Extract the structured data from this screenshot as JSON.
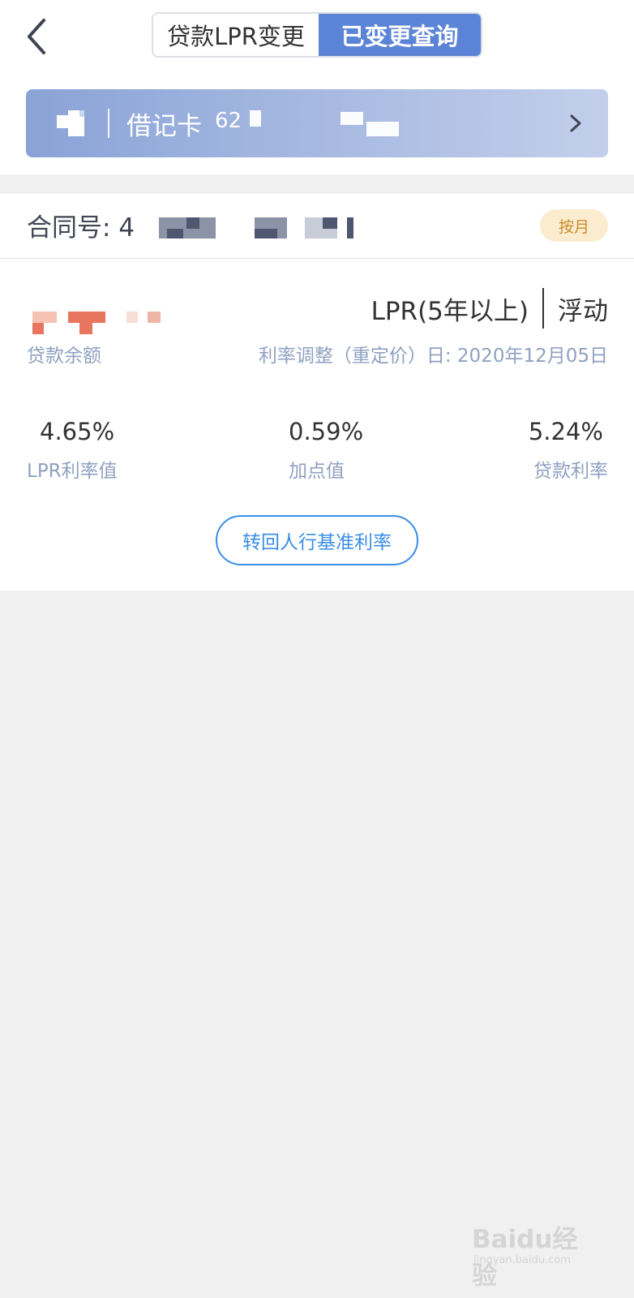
{
  "header": {
    "tab_change": "贷款LPR变更",
    "tab_query": "已变更查询",
    "active_tab": "已变更查询"
  },
  "account": {
    "card_label": "借记卡",
    "card_number_partial": "62"
  },
  "contract": {
    "label": "合同号:",
    "number_partial": "4",
    "repayment_badge": "按月"
  },
  "detail": {
    "balance_label": "贷款余额",
    "rate_type_main": "LPR(5年以上)",
    "rate_type_mode": "浮动",
    "reset_date": "利率调整（重定价）日: 2020年12月05日"
  },
  "stats": [
    {
      "value": "4.65%",
      "caption": "LPR利率值"
    },
    {
      "value": "0.59%",
      "caption": "加点值"
    },
    {
      "value": "5.24%",
      "caption": "贷款利率"
    }
  ],
  "actions": {
    "switch_button": "转回人行基准利率"
  },
  "watermark": {
    "title": "Baidu经验",
    "subtitle": "jingyan.baidu.com"
  },
  "colors": {
    "primary_blue": "#5b83d6",
    "button_blue": "#3a8ee6",
    "muted_text": "#8fa1c0",
    "badge_bg": "#fbecd0",
    "badge_text": "#c98a2b",
    "amount_mask": "#e8765e"
  }
}
